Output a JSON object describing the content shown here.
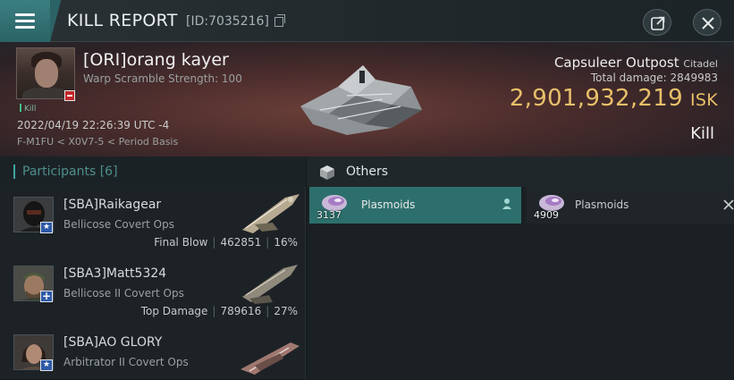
{
  "window": {
    "title": "KILL REPORT",
    "report_id": "[ID:7035216]"
  },
  "victim": {
    "name": "[ORI]orang kayer",
    "subtitle": "Warp Scramble Strength: 100",
    "tag": "Kill",
    "datetime": "2022/04/19 22:26:39 UTC -4",
    "location": "F-M1FU < X0V7-5 < Period Basis"
  },
  "target": {
    "name": "Capsuleer Outpost",
    "type": "Citadel",
    "total_damage_label": "Total damage:",
    "total_damage": "2849983",
    "isk_value": "2,901,932,219",
    "isk_unit": "ISK",
    "result": "Kill"
  },
  "participants": {
    "label": "Participants",
    "count": "[6]",
    "rows": [
      {
        "name": "[SBA]Raikagear",
        "ship": "Bellicose Covert Ops",
        "role": "Final Blow",
        "damage": "462851",
        "percent": "16%",
        "badge": "star"
      },
      {
        "name": "[SBA3]Matt5324",
        "ship": "Bellicose II Covert Ops",
        "role": "Top Damage",
        "damage": "789616",
        "percent": "27%",
        "badge": "plus"
      },
      {
        "name": "[SBA]AO GLORY",
        "ship": "Arbitrator II Covert Ops",
        "role": "",
        "damage": "",
        "percent": "",
        "badge": "star"
      }
    ]
  },
  "others": {
    "label": "Others",
    "items": [
      {
        "qty": "3137",
        "name": "Plasmoids"
      },
      {
        "qty": "4909",
        "name": "Plasmoids"
      }
    ]
  },
  "colors": {
    "accent_teal": "#2d6f6c",
    "isk_gold": "#e8c06a",
    "badge_red": "#c4262a",
    "badge_blue": "#2e5aa8"
  }
}
